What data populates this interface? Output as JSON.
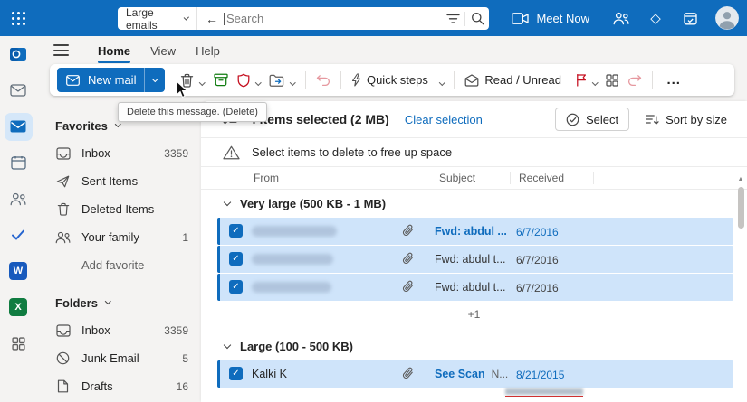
{
  "theme": {
    "accent": "#0f6cbd",
    "selected_row": "#cfe4fa",
    "header_bg": "#0f6cbd",
    "link": "#0f6cbd"
  },
  "topbar": {
    "scope": "Large emails",
    "search_placeholder": "Search",
    "meet_now": "Meet Now"
  },
  "ribbon": {
    "tabs": [
      {
        "label": "Home",
        "active": true
      },
      {
        "label": "View",
        "active": false
      },
      {
        "label": "Help",
        "active": false
      }
    ]
  },
  "toolbar": {
    "new_mail": "New mail",
    "quick_steps": "Quick steps",
    "read_unread": "Read / Unread",
    "more": "..."
  },
  "tooltip": {
    "text": "Delete this message. (Delete)"
  },
  "sidebar": {
    "sections": [
      {
        "title": "Favorites",
        "items": [
          {
            "label": "Inbox",
            "count": "3359"
          },
          {
            "label": "Sent Items",
            "count": ""
          },
          {
            "label": "Deleted Items",
            "count": ""
          },
          {
            "label": "Your family",
            "count": "1"
          },
          {
            "label": "Add favorite",
            "count": ""
          }
        ]
      },
      {
        "title": "Folders",
        "items": [
          {
            "label": "Inbox",
            "count": "3359"
          },
          {
            "label": "Junk Email",
            "count": "5"
          },
          {
            "label": "Drafts",
            "count": "16"
          }
        ]
      }
    ]
  },
  "main": {
    "selection_summary": "4 items selected (2 MB)",
    "clear_selection": "Clear selection",
    "select_button": "Select",
    "sort_button": "Sort by size",
    "banner": "Select items to delete to free up space",
    "columns": [
      "From",
      "Subject",
      "Received"
    ],
    "groups": [
      {
        "title": "Very large (500 KB - 1 MB)",
        "overflow": "+1",
        "rows": [
          {
            "from": "",
            "from_redacted": true,
            "subject": "Fwd: abdul ...",
            "received": "6/7/2016",
            "unread": true,
            "attachment": true,
            "selected": true
          },
          {
            "from": "",
            "from_redacted": true,
            "subject": "Fwd: abdul t...",
            "received": "6/7/2016",
            "unread": false,
            "attachment": true,
            "selected": true
          },
          {
            "from": "",
            "from_redacted": true,
            "subject": "Fwd: abdul t...",
            "received": "6/7/2016",
            "unread": false,
            "attachment": true,
            "selected": true
          }
        ]
      },
      {
        "title": "Large (100 - 500 KB)",
        "rows": [
          {
            "from": "Kalki K",
            "from_redacted": false,
            "subject": "See Scan",
            "preview": "N...",
            "received": "8/21/2015",
            "unread": true,
            "attachment": true,
            "selected": true
          }
        ]
      }
    ]
  },
  "icons": {
    "app-launcher": "3x3-dot-grid",
    "search": "magnifier",
    "filter": "funnel-lines",
    "back-arrow": "left-arrow",
    "camera": "video-camera",
    "teams": "two-people",
    "premium": "diamond",
    "my-day": "calendar-check",
    "avatar": "person-circle",
    "hamburger": "three-lines",
    "new-mail": "envelope",
    "delete": "trash-can",
    "archive": "archive-box",
    "report": "shield",
    "move-to": "folder-arrow",
    "undo": "undo-arrow",
    "quick-steps": "lightning-bolt",
    "read-unread": "open-envelope",
    "flag": "flag",
    "apps": "grid-2x2",
    "redo": "redo-arrow",
    "multi-select": "checklist",
    "select": "check-circle",
    "sort": "lines-arrow-down",
    "warning": "triangle-exclamation",
    "attachment": "paperclip",
    "checkbox": "check-mark"
  }
}
